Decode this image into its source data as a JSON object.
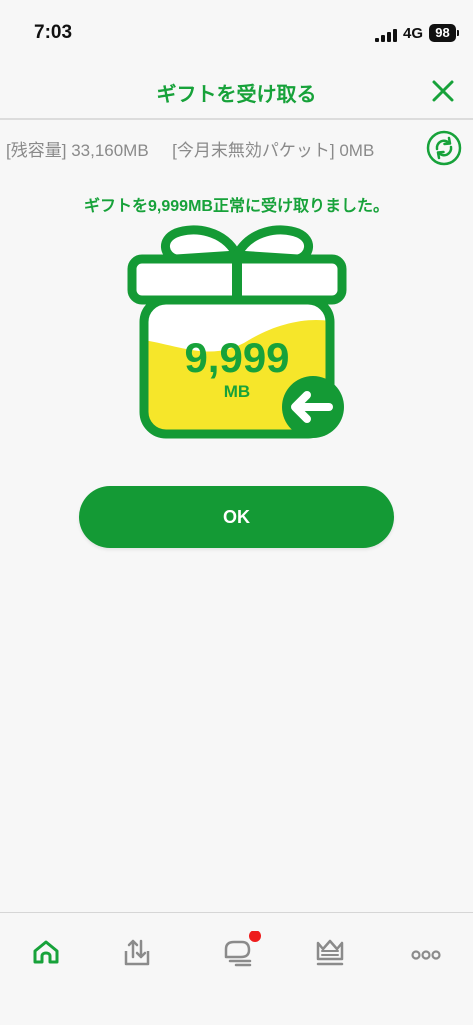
{
  "status_bar": {
    "time": "7:03",
    "network": "4G",
    "battery": "98"
  },
  "header": {
    "title": "ギフトを受け取る"
  },
  "info": {
    "remaining_label": "[残容量]",
    "remaining_value": "33,160MB",
    "expiring_label": "[今月末無効パケット]",
    "expiring_value": "0MB"
  },
  "message": "ギフトを9,999MB正常に受け取りました。",
  "gift": {
    "amount": "9,999",
    "unit": "MB"
  },
  "ok_button": {
    "label": "OK"
  },
  "tabbar": {
    "items": [
      {
        "icon": "home-icon",
        "active": true
      },
      {
        "icon": "upload-download-icon",
        "active": false
      },
      {
        "icon": "chat-icon",
        "active": false,
        "badge": true
      },
      {
        "icon": "crown-icon",
        "active": false
      },
      {
        "icon": "more-dots-icon",
        "active": false
      }
    ]
  },
  "colors": {
    "accent": "#17a23a",
    "button": "#149a35",
    "gift_fill": "#f6e62a",
    "badge": "#ee1c1c"
  }
}
